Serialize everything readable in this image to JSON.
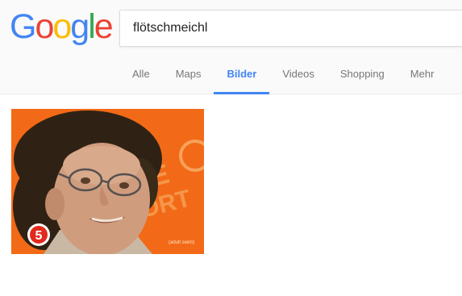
{
  "logo": {
    "letters": [
      {
        "char": "G",
        "color": "#4285f4"
      },
      {
        "char": "o",
        "color": "#ea4335"
      },
      {
        "char": "o",
        "color": "#fbbc05"
      },
      {
        "char": "g",
        "color": "#4285f4"
      },
      {
        "char": "l",
        "color": "#34a853"
      },
      {
        "char": "e",
        "color": "#ea4335"
      }
    ]
  },
  "search": {
    "value": "flötschmeichl"
  },
  "tabs": [
    {
      "label": "Alle",
      "active": false
    },
    {
      "label": "Maps",
      "active": false
    },
    {
      "label": "Bilder",
      "active": true
    },
    {
      "label": "Videos",
      "active": false
    },
    {
      "label": "Shopping",
      "active": false
    },
    {
      "label": "Mehr",
      "active": false
    }
  ],
  "results": {
    "image": {
      "channel_logo_text": "5",
      "caption": "(adult swim)"
    }
  },
  "colors": {
    "accent": "#4285f4",
    "tab_text": "#777777",
    "thumbnail_background": "#f26a17"
  }
}
